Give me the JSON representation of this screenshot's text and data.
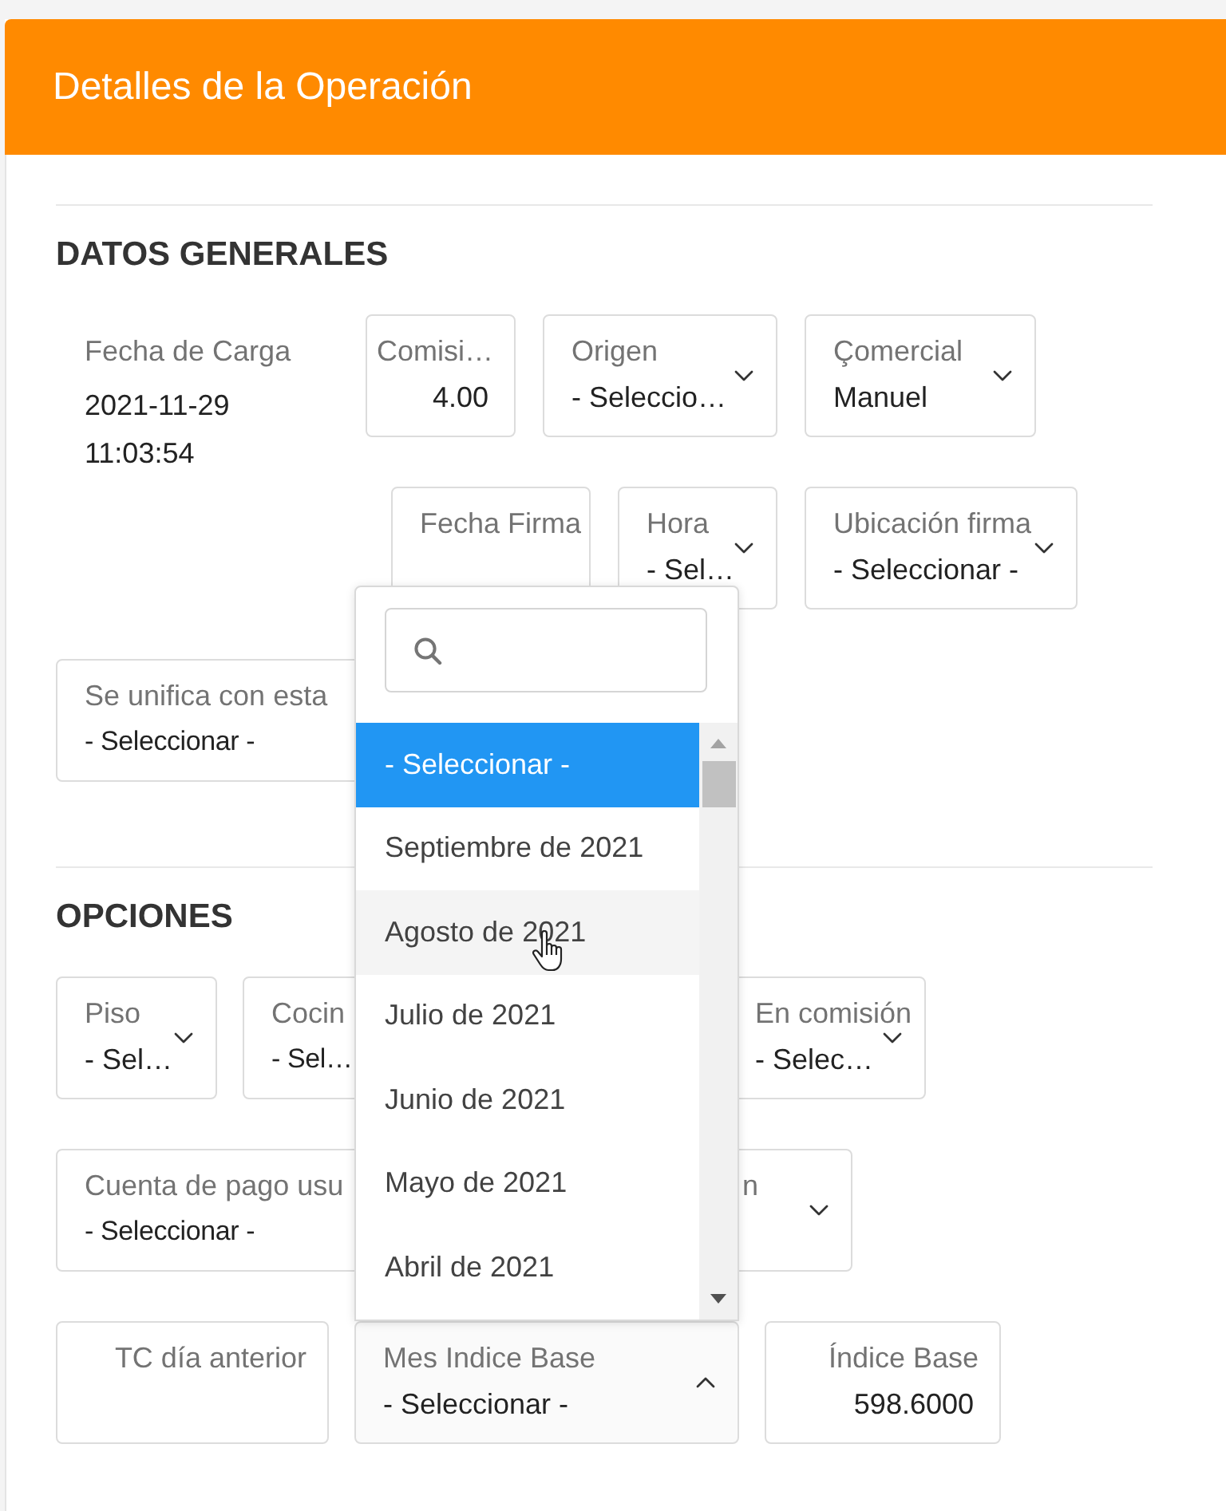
{
  "header": {
    "title": "Detalles de la Operación"
  },
  "sections": [
    {
      "title": "DATOS GENERALES",
      "fields": [
        {
          "kind": "static",
          "label": "Fecha de Carga",
          "value": "2021-11-29 11:03:54"
        },
        {
          "kind": "number",
          "label": "Comisi…",
          "value": "4.00"
        },
        {
          "kind": "select",
          "label": "Origen",
          "value": "- Seleccio…",
          "expanded": false
        },
        {
          "kind": "select",
          "label": "Çomercial",
          "value": "Manuel",
          "expanded": false
        },
        {
          "kind": "text",
          "label": "Fecha Firma"
        },
        {
          "kind": "select",
          "label": "Hora",
          "value": "- Sel…",
          "expanded": false
        },
        {
          "kind": "select",
          "label": "Ubicación firma",
          "value": "- Seleccionar -",
          "expanded": false
        },
        {
          "kind": "select",
          "label": "Se unifica con esta",
          "value": "- Seleccionar -"
        }
      ]
    },
    {
      "title": "OPCIONES",
      "fields": [
        {
          "kind": "select",
          "label": "Piso",
          "value": "- Sel…",
          "expanded": false
        },
        {
          "kind": "select",
          "label": "Cocin",
          "value": "- Sel…"
        },
        {
          "kind": "select",
          "label": "En comisión",
          "value": "- Selec…",
          "expanded": false
        },
        {
          "kind": "select",
          "label": "Cuenta de pago usu",
          "value": "- Seleccionar -"
        },
        {
          "kind": "select",
          "label": "n",
          "expanded": false
        },
        {
          "kind": "number",
          "label": "TC día anterior"
        },
        {
          "kind": "select",
          "label": "Mes Indice Base",
          "value": "- Seleccionar -",
          "expanded": true,
          "dropdown": {
            "options": [
              {
                "label": "- Seleccionar -",
                "selected": true,
                "hovered": false
              },
              {
                "label": "Septiembre de 2021",
                "selected": false,
                "hovered": false
              },
              {
                "label": "Agosto de 2021",
                "selected": false,
                "hovered": true
              },
              {
                "label": "Julio de 2021",
                "selected": false,
                "hovered": false
              },
              {
                "label": "Junio de 2021",
                "selected": false,
                "hovered": false
              },
              {
                "label": "Mayo de 2021",
                "selected": false,
                "hovered": false
              },
              {
                "label": "Abril de 2021",
                "selected": false,
                "hovered": false
              }
            ]
          }
        },
        {
          "kind": "number",
          "label": "Índice Base",
          "value": "598.6000"
        }
      ]
    }
  ]
}
